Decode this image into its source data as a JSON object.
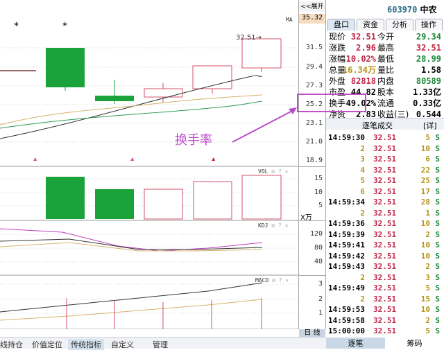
{
  "chart": {
    "annotation_price": "32.51→",
    "callout_text": "换手率",
    "ma_label": "MA",
    "vol_label": "VOL",
    "kdj_label": "KDJ",
    "macd_label": "MACD",
    "panel_icons": [
      "gear-icon",
      "help-icon",
      "close-icon"
    ],
    "star": "*"
  },
  "axis": {
    "expand_button": "<<展开",
    "top_value": "35.32",
    "price_ticks": [
      "31.5",
      "29.4",
      "27.3",
      "25.2",
      "23.1",
      "21.0",
      "18.9"
    ],
    "vol_ticks": [
      "15",
      "10",
      "5"
    ],
    "vol_unit": "X万",
    "kdj_ticks": [
      "120",
      "80",
      "40"
    ],
    "macd_ticks": [
      "3",
      "2",
      "1"
    ],
    "period": "日 线"
  },
  "quote": {
    "code": "603970",
    "name": "中农",
    "tabs": [
      "盘口",
      "资金",
      "分析",
      "操作"
    ],
    "rows": [
      {
        "l1": "现价",
        "v1": "32.51",
        "l2": "今开",
        "v2": "29.34"
      },
      {
        "l1": "涨跌",
        "v1": "2.96",
        "l2": "最高",
        "v2": "32.51"
      },
      {
        "l1": "涨幅",
        "v1": "10.02%",
        "l2": "最低",
        "v2": "28.99"
      },
      {
        "l1": "总量",
        "v1": "16.34万",
        "l2": "量比",
        "v2": "1.58"
      },
      {
        "l1": "外盘",
        "v1": "82818",
        "l2": "内盘",
        "v2": "80589"
      },
      {
        "l1": "市盈",
        "v1": "44.82",
        "l2": "股本",
        "v2": "1.33亿"
      },
      {
        "l1": "换手",
        "v1": "49.02%",
        "l2": "流通",
        "v2": "0.33亿"
      },
      {
        "l1": "净资",
        "v1": "2.83",
        "l2": "收益(三)",
        "v2": "0.544"
      }
    ],
    "ticks_title": "逐笔成交",
    "ticks_detail": "[详]",
    "ticks": [
      {
        "t": "14:59:30",
        "p": "32.51",
        "v": "5",
        "s": "S"
      },
      {
        "t": "2",
        "p": "32.51",
        "v": "10",
        "s": "S"
      },
      {
        "t": "3",
        "p": "32.51",
        "v": "6",
        "s": "S"
      },
      {
        "t": "4",
        "p": "32.51",
        "v": "22",
        "s": "S"
      },
      {
        "t": "5",
        "p": "32.51",
        "v": "25",
        "s": "S"
      },
      {
        "t": "6",
        "p": "32.51",
        "v": "17",
        "s": "S"
      },
      {
        "t": "14:59:34",
        "p": "32.51",
        "v": "28",
        "s": "S"
      },
      {
        "t": "2",
        "p": "32.51",
        "v": "1",
        "s": "S"
      },
      {
        "t": "14:59:36",
        "p": "32.51",
        "v": "10",
        "s": "S"
      },
      {
        "t": "14:59:39",
        "p": "32.51",
        "v": "2",
        "s": "S"
      },
      {
        "t": "14:59:41",
        "p": "32.51",
        "v": "10",
        "s": "S"
      },
      {
        "t": "14:59:42",
        "p": "32.51",
        "v": "10",
        "s": "S"
      },
      {
        "t": "14:59:43",
        "p": "32.51",
        "v": "2",
        "s": "S"
      },
      {
        "t": "2",
        "p": "32.51",
        "v": "3",
        "s": "S"
      },
      {
        "t": "14:59:49",
        "p": "32.51",
        "v": "5",
        "s": "S"
      },
      {
        "t": "2",
        "p": "32.51",
        "v": "15",
        "s": "S"
      },
      {
        "t": "14:59:53",
        "p": "32.51",
        "v": "10",
        "s": "S"
      },
      {
        "t": "14:59:58",
        "p": "32.51",
        "v": "2",
        "s": "S"
      },
      {
        "t": "15:00:00",
        "p": "32.51",
        "v": "5",
        "s": "S"
      }
    ],
    "bottom_tabs": [
      "逐笔",
      "筹码"
    ]
  },
  "bottom_tabs": [
    "线持仓",
    "价值定位",
    "传统指标",
    "自定义",
    "管理"
  ]
}
